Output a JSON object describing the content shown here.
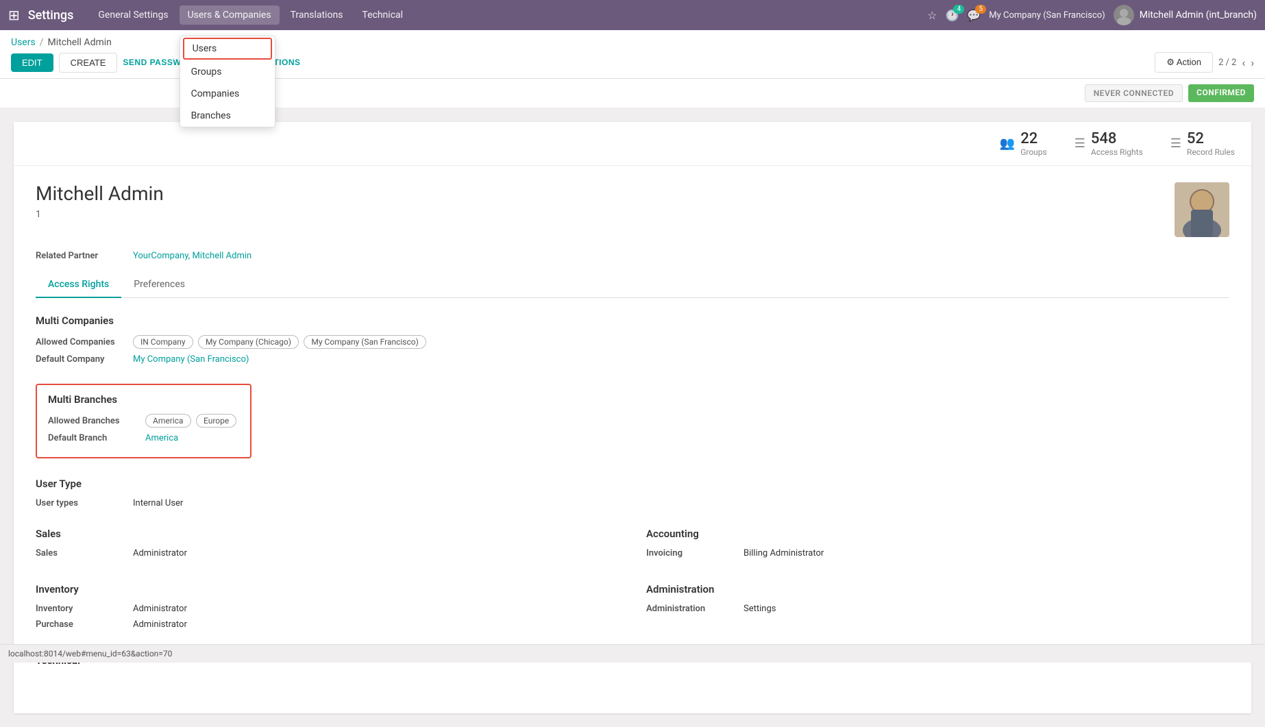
{
  "navbar": {
    "app_grid_icon": "⊞",
    "title": "Settings",
    "menu_items": [
      {
        "id": "general",
        "label": "General Settings"
      },
      {
        "id": "users_companies",
        "label": "Users & Companies",
        "active": true
      },
      {
        "id": "translations",
        "label": "Translations"
      },
      {
        "id": "technical",
        "label": "Technical"
      }
    ],
    "icons": {
      "star": "☆",
      "clock": "🕐",
      "chat": "💬"
    },
    "clock_badge": "4",
    "chat_badge": "5",
    "company": "My Company (San Francisco)",
    "user": "Mitchell Admin (int_branch)"
  },
  "dropdown": {
    "items": [
      {
        "id": "users",
        "label": "Users",
        "highlighted": true
      },
      {
        "id": "groups",
        "label": "Groups"
      },
      {
        "id": "companies",
        "label": "Companies"
      },
      {
        "id": "branches",
        "label": "Branches"
      }
    ]
  },
  "breadcrumb": {
    "parent_label": "Users",
    "current_label": "Mitchell Admin"
  },
  "buttons": {
    "edit": "EDIT",
    "create": "CREATE",
    "password_reset": "SEND PASSWORD RESET INSTRUCTIONS"
  },
  "toolbar": {
    "action_label": "⚙ Action",
    "pagination": "2 / 2"
  },
  "status": {
    "never_connected": "NEVER CONNECTED",
    "confirmed": "CONFIRMED"
  },
  "stats": [
    {
      "id": "groups",
      "icon": "👥",
      "count": "22",
      "label": "Groups"
    },
    {
      "id": "access_rights",
      "icon": "≡",
      "count": "548",
      "label": "Access Rights"
    },
    {
      "id": "record_rules",
      "icon": "≡",
      "count": "52",
      "label": "Record Rules"
    }
  ],
  "user_profile": {
    "name": "Mitchell Admin",
    "id": "1",
    "related_partner_label": "Related Partner",
    "related_partner_value": "YourCompany, Mitchell Admin",
    "photo_alt": "Mitchell Admin photo"
  },
  "tabs": [
    {
      "id": "access_rights",
      "label": "Access Rights",
      "active": true
    },
    {
      "id": "preferences",
      "label": "Preferences"
    }
  ],
  "access_rights": {
    "multi_companies": {
      "title": "Multi Companies",
      "allowed_companies_label": "Allowed Companies",
      "allowed_companies": [
        "IN Company",
        "My Company (Chicago)",
        "My Company (San Francisco)"
      ],
      "default_company_label": "Default Company",
      "default_company": "My Company (San Francisco)"
    },
    "multi_branches": {
      "title": "Multi Branches",
      "allowed_branches_label": "Allowed Branches",
      "allowed_branches": [
        "America",
        "Europe"
      ],
      "default_branch_label": "Default Branch",
      "default_branch": "America"
    },
    "user_type": {
      "title": "User Type",
      "user_types_label": "User types",
      "user_types_value": "Internal User"
    },
    "sales": {
      "title": "Sales",
      "sales_label": "Sales",
      "sales_value": "Administrator"
    },
    "accounting": {
      "title": "Accounting",
      "invoicing_label": "Invoicing",
      "invoicing_value": "Billing Administrator"
    },
    "inventory": {
      "title": "Inventory",
      "inventory_label": "Inventory",
      "inventory_value": "Administrator",
      "purchase_label": "Purchase",
      "purchase_value": "Administrator"
    },
    "administration": {
      "title": "Administration",
      "admin_label": "Administration",
      "admin_value": "Settings"
    },
    "technical": {
      "title": "Technical"
    }
  },
  "url_bar": {
    "url": "localhost:8014/web#menu_id=63&action=70"
  }
}
